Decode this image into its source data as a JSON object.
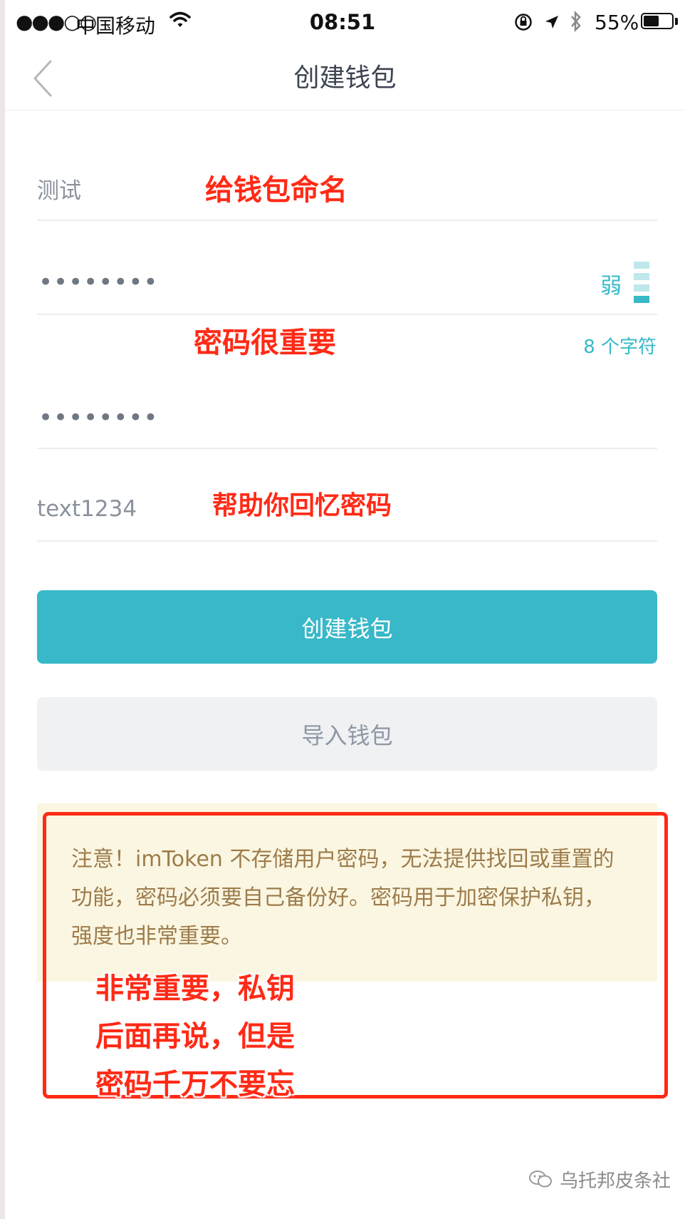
{
  "status_bar": {
    "signal": "●●●○○",
    "carrier": "中国移动",
    "time": "08:51",
    "battery_text": "55%",
    "battery_level": 0.55,
    "icons": [
      "wifi-icon",
      "orientation-lock-icon",
      "location-arrow-icon",
      "bluetooth-icon",
      "battery-icon"
    ]
  },
  "nav": {
    "title": "创建钱包",
    "back_icon": "chevron-left-icon"
  },
  "form": {
    "wallet_name_value": "测试",
    "password_value": "••••••••",
    "password_strength_label": "弱",
    "password_strength_level": 1,
    "password_strength_max": 4,
    "password_char_count": "8 个字符",
    "confirm_password_value": "••••••••",
    "password_hint_value": "text1234"
  },
  "buttons": {
    "create_label": "创建钱包",
    "import_label": "导入钱包"
  },
  "notice": {
    "text": "注意！imToken 不存储用户密码，无法提供找回或重置的功能，密码必须要自己备份好。密码用于加密保护私钥，强度也非常重要。"
  },
  "annotations": {
    "name_callout": "给钱包命名",
    "password_callout": "密码很重要",
    "hint_callout": "帮助你回忆密码",
    "notice_callout_lines": [
      "非常重要，私钥",
      "后面再说，但是",
      "密码千万不要忘"
    ]
  },
  "watermark": {
    "text": "乌托邦皮条社"
  },
  "colors": {
    "accent": "#38b8c8",
    "annotation_red": "#ff2a16",
    "notice_bg": "#fbf6e1",
    "notice_text": "#9c7c4c"
  }
}
